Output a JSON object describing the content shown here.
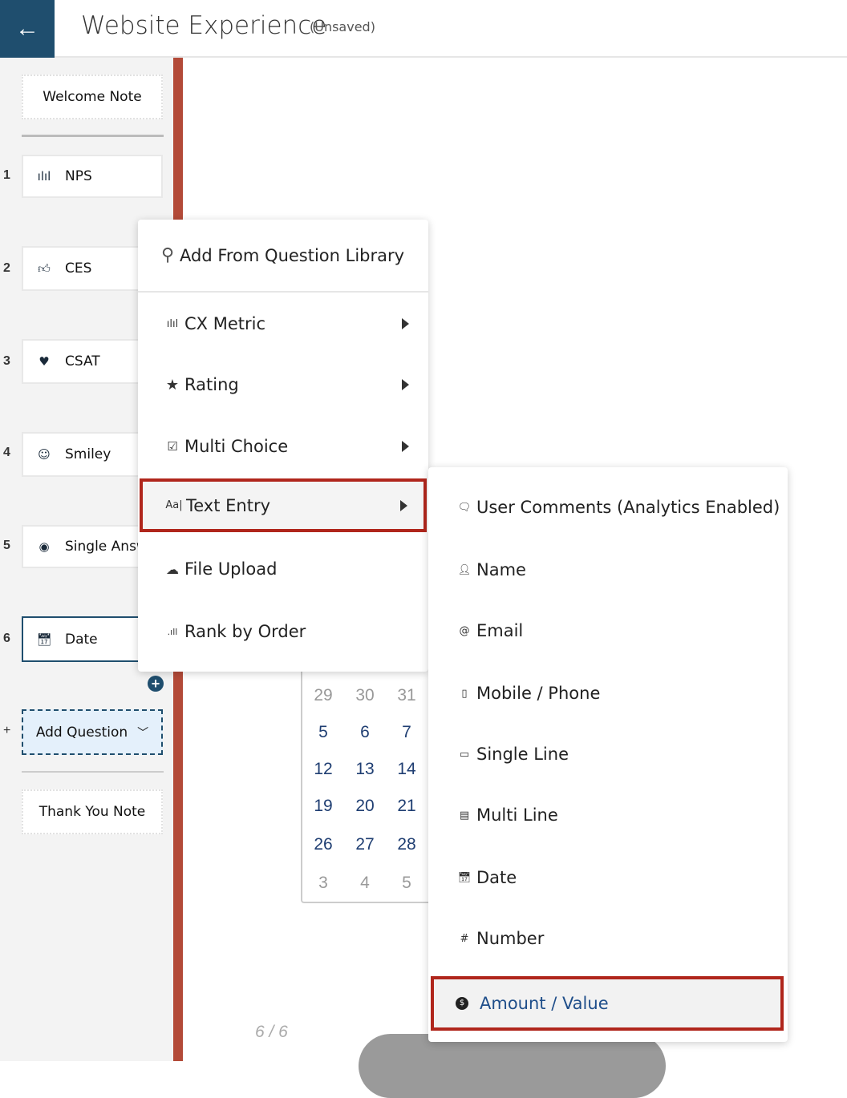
{
  "header": {
    "title": "Website Experience",
    "status": "(Unsaved)",
    "back_icon": "arrow-left-icon"
  },
  "sidebar": {
    "welcome": "Welcome Note",
    "questions": [
      {
        "num": "1",
        "label": "NPS",
        "icon": "nps-icon"
      },
      {
        "num": "2",
        "label": "CES",
        "icon": "thumbs-up-icon"
      },
      {
        "num": "3",
        "label": "CSAT",
        "icon": "heart-icon"
      },
      {
        "num": "4",
        "label": "Smiley",
        "icon": "smiley-icon"
      },
      {
        "num": "5",
        "label": "Single Answ",
        "icon": "radio-icon"
      },
      {
        "num": "6",
        "label": "Date",
        "icon": "calendar-icon"
      }
    ],
    "add_prefix": "+",
    "add_question": "Add Question",
    "thank_you": "Thank You Note"
  },
  "menu": {
    "library": "Add From Question Library",
    "items": [
      {
        "label": "CX Metric",
        "icon": "cx-metric-icon"
      },
      {
        "label": "Rating",
        "icon": "star-icon"
      },
      {
        "label": "Multi Choice",
        "icon": "checkbox-icon"
      },
      {
        "label": "Text Entry",
        "icon": "text-entry-icon",
        "icon_text": "Aa|"
      },
      {
        "label": "File Upload",
        "icon": "cloud-upload-icon"
      },
      {
        "label": "Rank by Order",
        "icon": "rank-icon"
      }
    ]
  },
  "submenu": {
    "items": [
      {
        "label": "User Comments (Analytics Enabled)",
        "icon": "comment-icon"
      },
      {
        "label": "Name",
        "icon": "person-icon"
      },
      {
        "label": "Email",
        "icon": "at-icon"
      },
      {
        "label": "Mobile / Phone",
        "icon": "mobile-icon"
      },
      {
        "label": "Single Line",
        "icon": "single-line-icon"
      },
      {
        "label": "Multi Line",
        "icon": "multi-line-icon"
      },
      {
        "label": "Date",
        "icon": "calendar-icon"
      },
      {
        "label": "Number",
        "icon": "hash-icon"
      },
      {
        "label": "Amount / Value",
        "icon": "dollar-circle-icon"
      }
    ]
  },
  "calendar": {
    "rows": [
      [
        "29",
        "30",
        "31"
      ],
      [
        "5",
        "6",
        "7"
      ],
      [
        "12",
        "13",
        "14"
      ],
      [
        "19",
        "20",
        "21"
      ],
      [
        "26",
        "27",
        "28"
      ],
      [
        "3",
        "4",
        "5"
      ]
    ]
  },
  "pager": "6 / 6",
  "colors": {
    "brand": "#1f4e6e",
    "accent_bar": "#b34a38",
    "highlight": "#b0261c",
    "link": "#1f4e8a"
  }
}
